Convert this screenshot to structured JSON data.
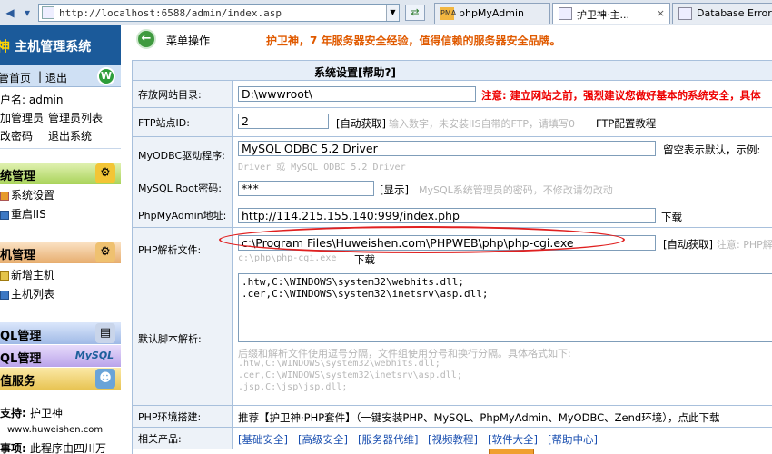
{
  "browser": {
    "url": "http://localhost:6588/admin/index.asp",
    "tabs": [
      {
        "label": "phpMyAdmin",
        "icon": "PMA"
      },
      {
        "label": "护卫神·主...",
        "icon": "page-icon"
      },
      {
        "label": "Database Error",
        "icon": "page-icon"
      }
    ]
  },
  "sidebar": {
    "logo_a": "神",
    "logo_b": "主机管理系统",
    "home": "管首页",
    "sep": "|",
    "logout": "退出",
    "user_line": "户名: admin",
    "links_a": "加管理员",
    "links_b": "管理员列表",
    "links_c": "改密码",
    "links_d": "退出系统",
    "sec1": "统管理",
    "sec1_items": [
      "系统设置",
      "重启IIS"
    ],
    "sec2": "机管理",
    "sec2_items": [
      "新增主机",
      "主机列表"
    ],
    "sec3": "QL管理",
    "sec4": "QL管理",
    "sec4_badge": "MySQL",
    "sec5": "值服务",
    "support_label": "支持: ",
    "support_value": "护卫神",
    "support_url": "www.huweishen.com",
    "note_label": "事项: ",
    "note_value": "此程序由四川万"
  },
  "main": {
    "menu_label": "菜单操作",
    "slogan": "护卫神，7 年服务器安全经验，值得信赖的服务器安全品牌。",
    "form_title": "系统设置[帮助?]",
    "rows": {
      "webroot": {
        "label": "存放网站目录:",
        "value": "D:\\wwwroot\\",
        "note": "注意: 建立网站之前，强烈建议您做好基本的系统安全，具体"
      },
      "ftp": {
        "label": "FTP站点ID:",
        "value": "2",
        "auto": "[自动获取]",
        "hint": "输入数字，未安装IIS自带的FTP，请填写0",
        "tutorial": "FTP配置教程"
      },
      "odbc": {
        "label": "MyODBC驱动程序:",
        "value": "MySQL ODBC 5.2 Driver",
        "note": "留空表示默认，示例:",
        "hint": "Driver 或 MySQL ODBC 5.2 Driver"
      },
      "mysqlroot": {
        "label": "MySQL Root密码:",
        "value": "***",
        "show": "[显示]",
        "hint": "MySQL系统管理员的密码，不修改请勿改动"
      },
      "pma": {
        "label": "PhpMyAdmin地址:",
        "value": "http://114.215.155.140:999/index.php",
        "download": "下载"
      },
      "php": {
        "label": "PHP解析文件:",
        "value": "c:\\Program Files\\Huweishen.com\\PHPWEB\\php\\php-cgi.exe",
        "auto": "[自动获取]",
        "hint": "注意: PHP解",
        "hint2": "c:\\php\\php-cgi.exe",
        "download": "下载"
      },
      "script": {
        "label": "默认脚本解析:",
        "value": ".htw,C:\\WINDOWS\\system32\\webhits.dll;\n.cer,C:\\WINDOWS\\system32\\inetsrv\\asp.dll;",
        "hint": "后缀和解析文件使用逗号分隔，文件组使用分号和换行分隔。具体格式如下:",
        "examples": [
          ".htw,C:\\WINDOWS\\system32\\webhits.dll;",
          ".cer,C:\\WINDOWS\\system32\\inetsrv\\asp.dll;",
          ".jsp,C:\\jsp\\jsp.dll;"
        ]
      },
      "phpenv": {
        "label": "PHP环境搭建:",
        "text": "推荐【护卫神·PHP套件】（一键安装PHP、MySQL、PhpMyAdmin、MyODBC、Zend环境），点此下载"
      },
      "products": {
        "label": "相关产品:",
        "links": [
          "[基础安全]",
          "[高级安全]",
          "[服务器代维]",
          "[视频教程]",
          "[软件大全]",
          "[帮助中心]"
        ]
      }
    }
  },
  "colors": {
    "accent": "#1b5a9a",
    "slogan": "#e05a00",
    "warn": "#e00000",
    "highlight": "#e02020"
  }
}
